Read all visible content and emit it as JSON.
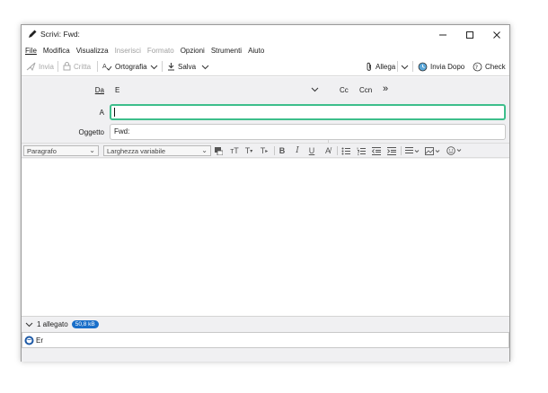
{
  "window": {
    "title": "Scrivi: Fwd:"
  },
  "menu": [
    {
      "label": "File",
      "disabled": false
    },
    {
      "label": "Modifica",
      "disabled": false
    },
    {
      "label": "Visualizza",
      "disabled": false
    },
    {
      "label": "Inserisci",
      "disabled": true
    },
    {
      "label": "Formato",
      "disabled": true
    },
    {
      "label": "Opzioni",
      "disabled": false
    },
    {
      "label": "Strumenti",
      "disabled": false
    },
    {
      "label": "Aiuto",
      "disabled": false
    }
  ],
  "toolbar": {
    "send": "Invia",
    "encrypt": "Critta",
    "spelling": "Ortografia",
    "save": "Salva",
    "attach": "Allega",
    "send_later": "Invia Dopo",
    "check": "Check"
  },
  "headers": {
    "from_label": "Da",
    "from_value": "E",
    "cc_label": "Cc",
    "bcc_label": "Ccn",
    "more_label": "»",
    "to_label": "A",
    "to_value": "",
    "subject_label": "Oggetto",
    "subject_value": "Fwd:"
  },
  "format": {
    "paragraph": "Paragrafo",
    "font": "Larghezza variabile"
  },
  "attachments": {
    "count_label": "1 allegato",
    "size": "50,8 kB",
    "items": [
      {
        "name": "Er"
      }
    ]
  },
  "colors": {
    "focus_border": "#3dbe8b",
    "badge": "#1a6fc9"
  }
}
